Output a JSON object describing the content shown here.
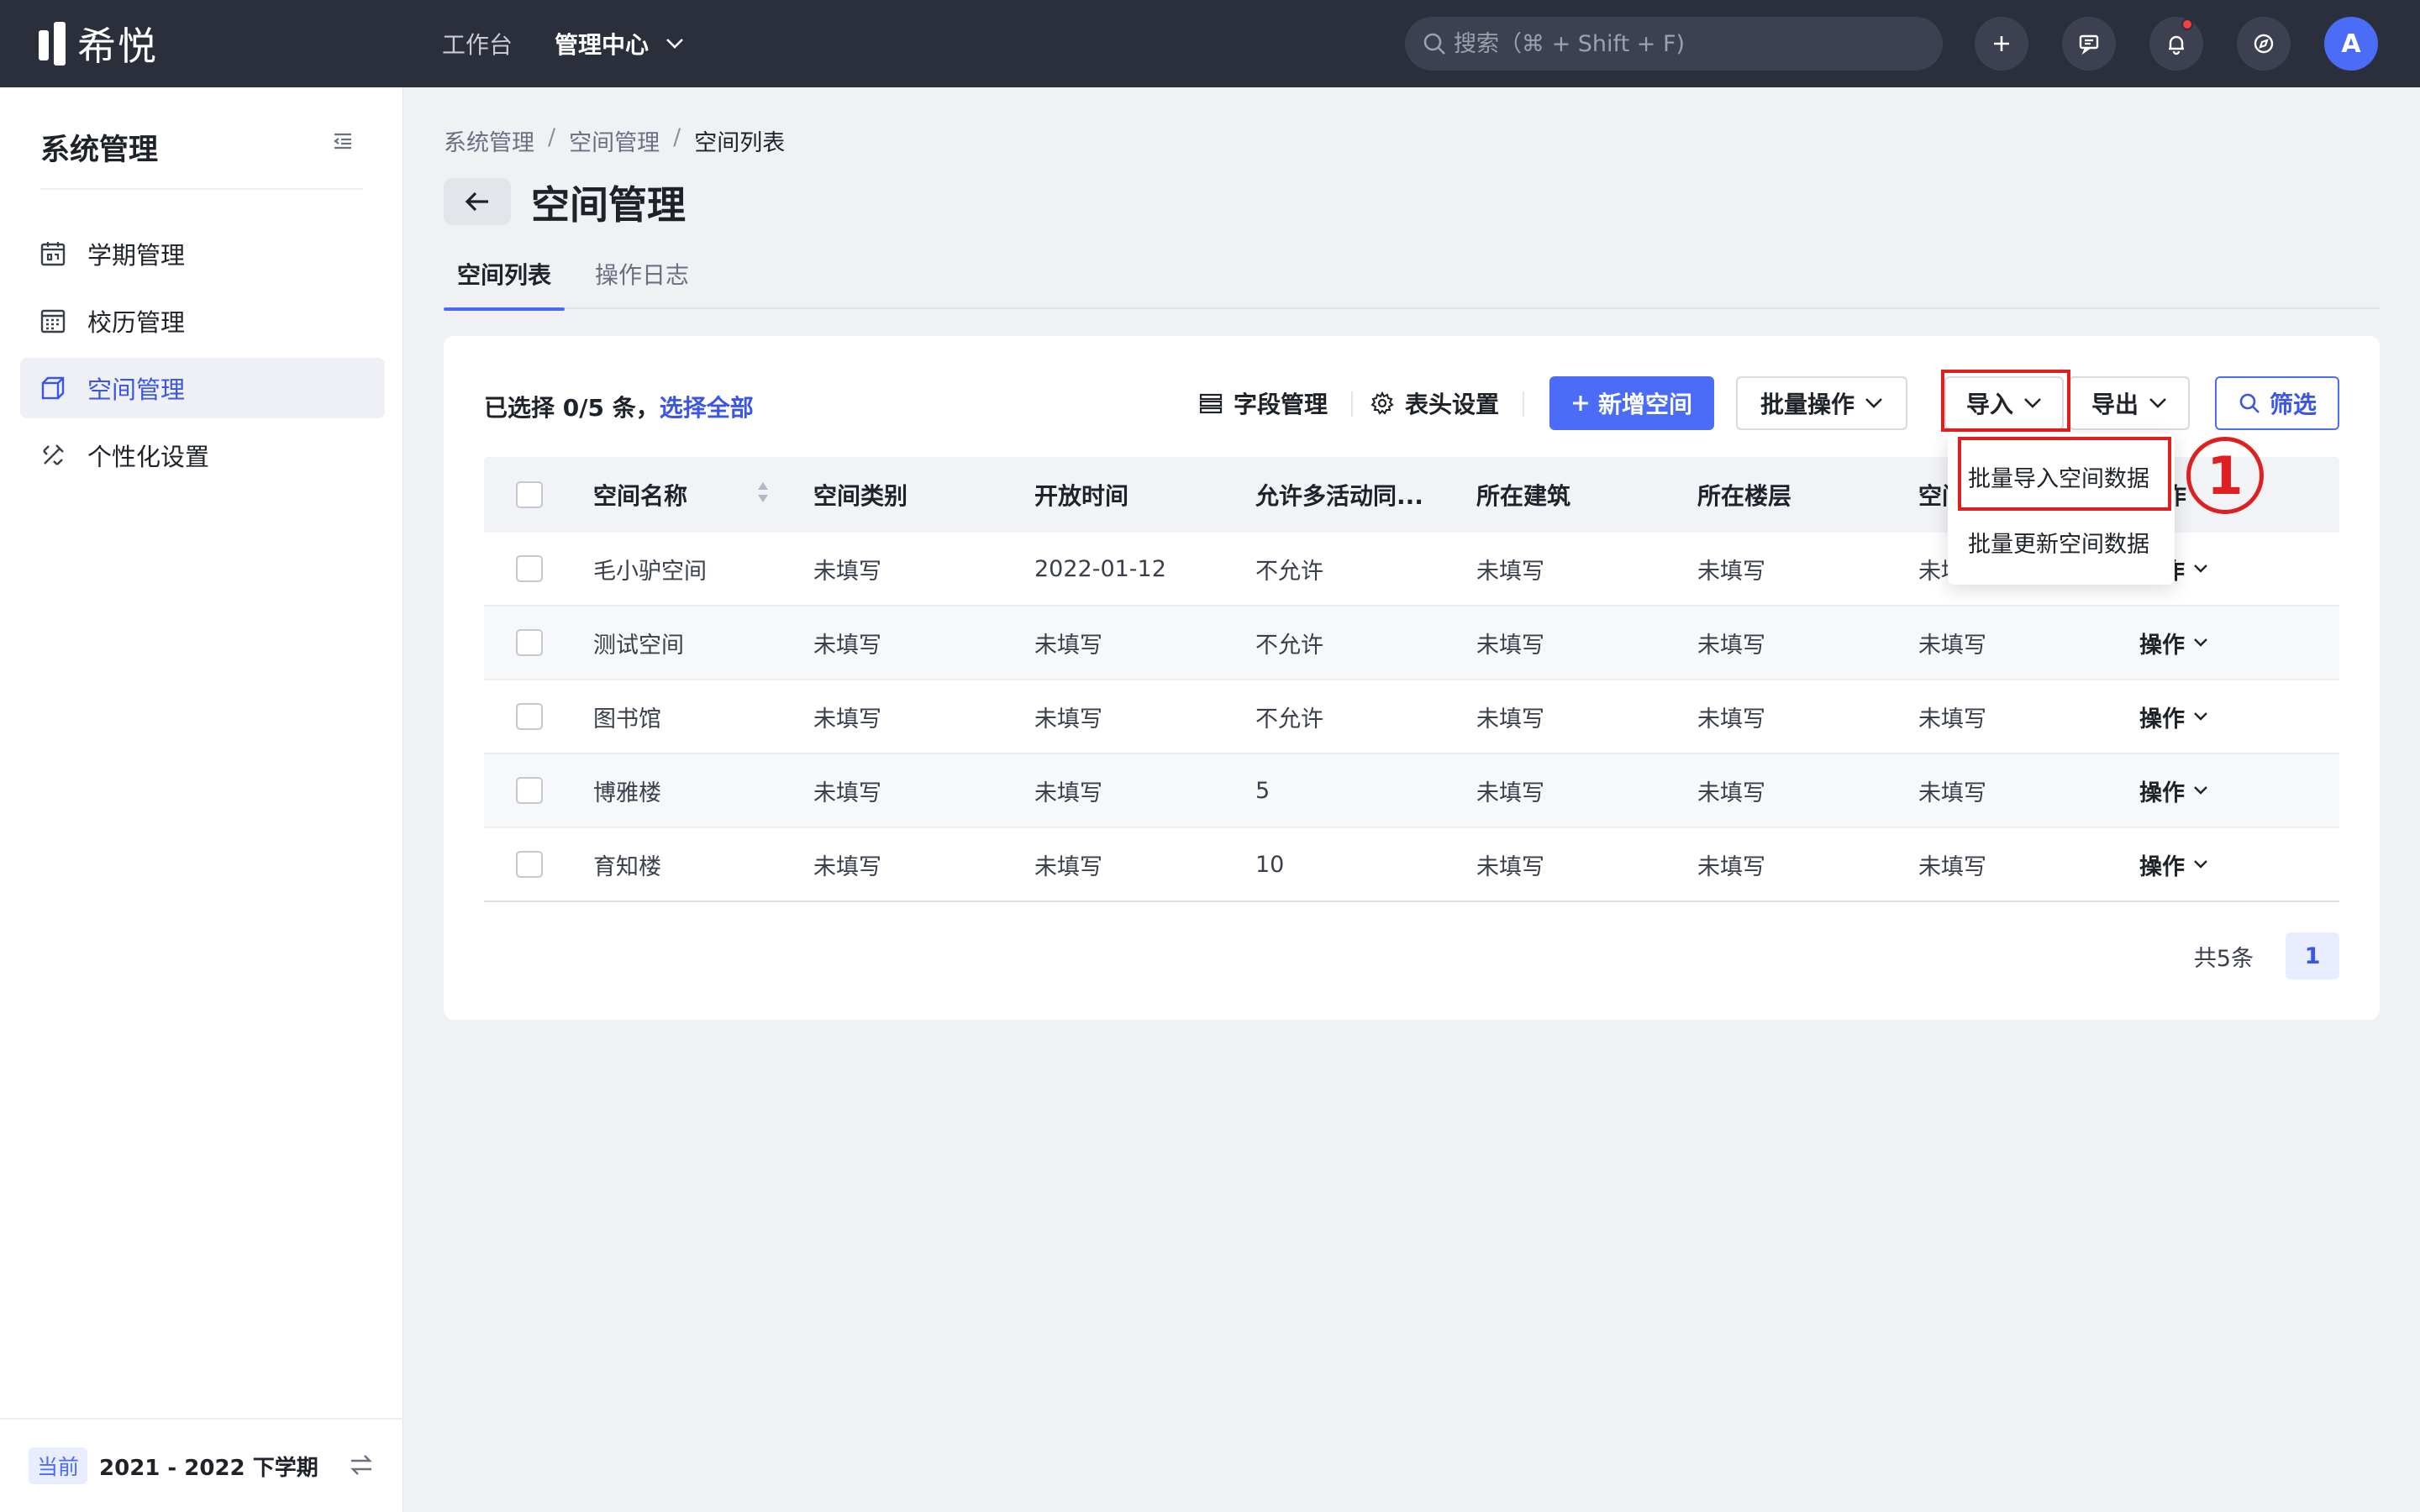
{
  "app": {
    "logo_text": "希悦"
  },
  "topnav": {
    "items": [
      {
        "label": "工作台"
      },
      {
        "label": "管理中心"
      }
    ],
    "search_placeholder": "搜索（⌘ + Shift + F)",
    "avatar_letter": "A"
  },
  "sidebar": {
    "title": "系统管理",
    "items": [
      {
        "label": "学期管理",
        "icon": "calendar-icon"
      },
      {
        "label": "校历管理",
        "icon": "calendar-grid-icon"
      },
      {
        "label": "空间管理",
        "icon": "cube-icon",
        "active": true
      },
      {
        "label": "个性化设置",
        "icon": "brush-icon"
      }
    ],
    "footer": {
      "badge": "当前",
      "term": "2021 - 2022 下学期"
    }
  },
  "breadcrumb": [
    "系统管理",
    "空间管理",
    "空间列表"
  ],
  "page_title": "空间管理",
  "tabs": [
    {
      "label": "空间列表",
      "active": true
    },
    {
      "label": "操作日志"
    }
  ],
  "toolbar": {
    "selected_text": "已选择 0/5 条，",
    "select_all": "选择全部",
    "field_manage": "字段管理",
    "header_settings": "表头设置",
    "add_space": "新增空间",
    "batch_ops": "批量操作",
    "import": "导入",
    "export": "导出",
    "filter": "筛选"
  },
  "table": {
    "headers": [
      "空间名称",
      "空间类别",
      "开放时间",
      "允许多活动同...",
      "所在建筑",
      "所在楼层",
      "空间",
      "操作"
    ],
    "rows": [
      [
        "毛小驴空间",
        "未填写",
        "2022-01-12",
        "不允许",
        "未填写",
        "未填写",
        "未填写",
        "操作"
      ],
      [
        "测试空间",
        "未填写",
        "未填写",
        "不允许",
        "未填写",
        "未填写",
        "未填写",
        "操作"
      ],
      [
        "图书馆",
        "未填写",
        "未填写",
        "不允许",
        "未填写",
        "未填写",
        "未填写",
        "操作"
      ],
      [
        "博雅楼",
        "未填写",
        "未填写",
        "5",
        "未填写",
        "未填写",
        "未填写",
        "操作"
      ],
      [
        "育知楼",
        "未填写",
        "未填写",
        "10",
        "未填写",
        "未填写",
        "未填写",
        "操作"
      ]
    ]
  },
  "pagination": {
    "total": "共5条",
    "current": "1"
  },
  "import_menu": {
    "items": [
      "批量导入空间数据",
      "批量更新空间数据"
    ]
  },
  "annotation": {
    "step": "1"
  },
  "colors": {
    "accent": "#4a6cf7",
    "topbar": "#2b2e3b",
    "highlight": "#e02020"
  }
}
